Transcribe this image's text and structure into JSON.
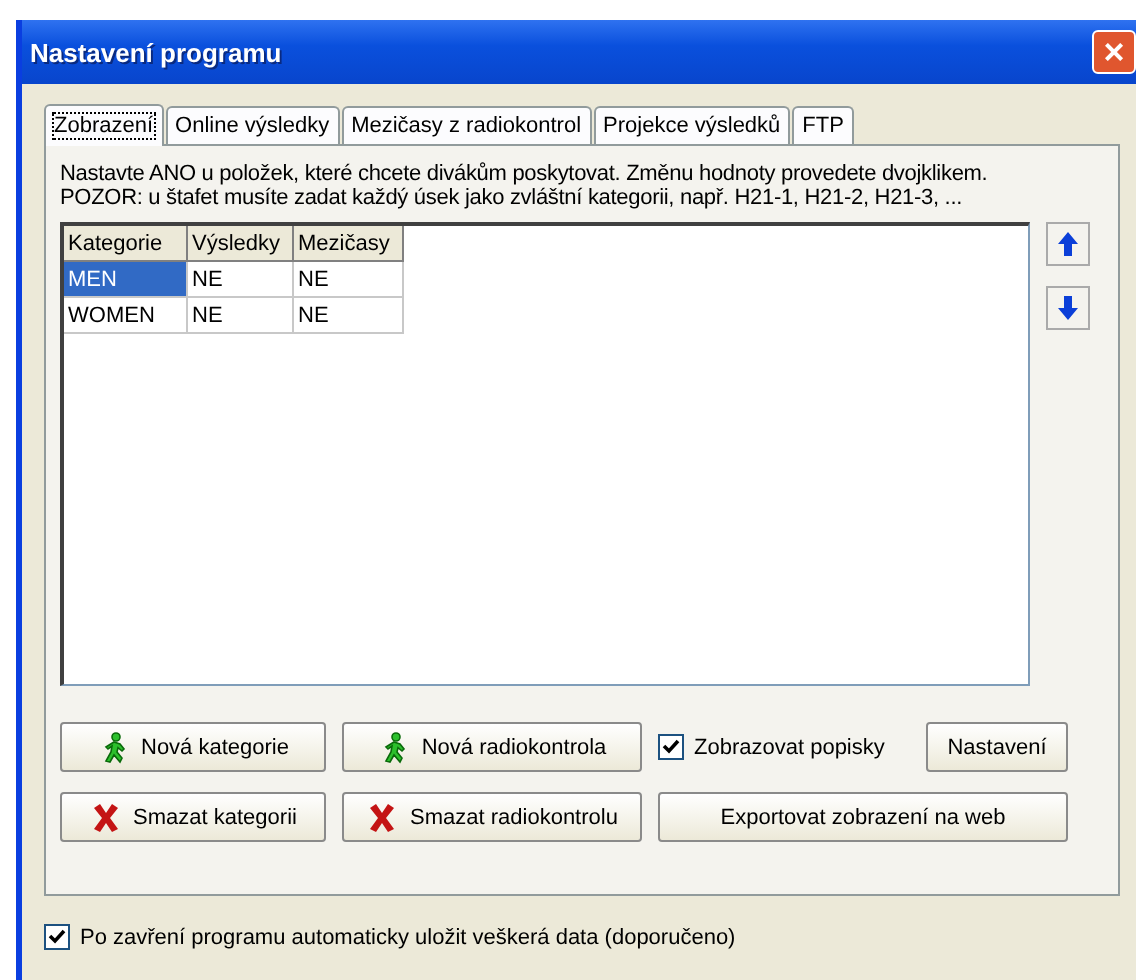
{
  "window": {
    "title": "Nastavení programu",
    "close": "×"
  },
  "tabs": [
    {
      "label": "Zobrazení",
      "selected": true
    },
    {
      "label": "Online výsledky",
      "selected": false
    },
    {
      "label": "Mezičasy z radiokontrol",
      "selected": false
    },
    {
      "label": "Projekce výsledků",
      "selected": false
    },
    {
      "label": "FTP",
      "selected": false
    }
  ],
  "info": [
    "Nastavte ANO u položek, které chcete divákům poskytovat. Změnu hodnoty provedete dvojklikem.",
    "POZOR: u štafet musíte zadat každý úsek jako zvláštní kategorii, např. H21-1, H21-2, H21-3, ..."
  ],
  "table": {
    "columns": [
      "Kategorie",
      "Výsledky",
      "Mezičasy"
    ],
    "rows": [
      {
        "cells": [
          "MEN",
          "NE",
          "NE"
        ],
        "selected": true
      },
      {
        "cells": [
          "WOMEN",
          "NE",
          "NE"
        ],
        "selected": false
      }
    ]
  },
  "buttons": [
    {
      "label": "Nová kategorie",
      "kind": "add"
    },
    {
      "label": "Nová radiokontrola",
      "kind": "add"
    },
    {
      "label": "Smazat kategorii",
      "kind": "delete"
    },
    {
      "label": "Smazat radiokontrolu",
      "kind": "delete"
    }
  ],
  "show_labels": {
    "label": "Zobrazovat popisky",
    "checked": true
  },
  "settings_button": "Nastavení",
  "export_button": "Exportovat zobrazení na web",
  "autosave": {
    "label": "Po zavření programu automaticky uložit veškerá data (doporučeno)",
    "checked": true
  }
}
